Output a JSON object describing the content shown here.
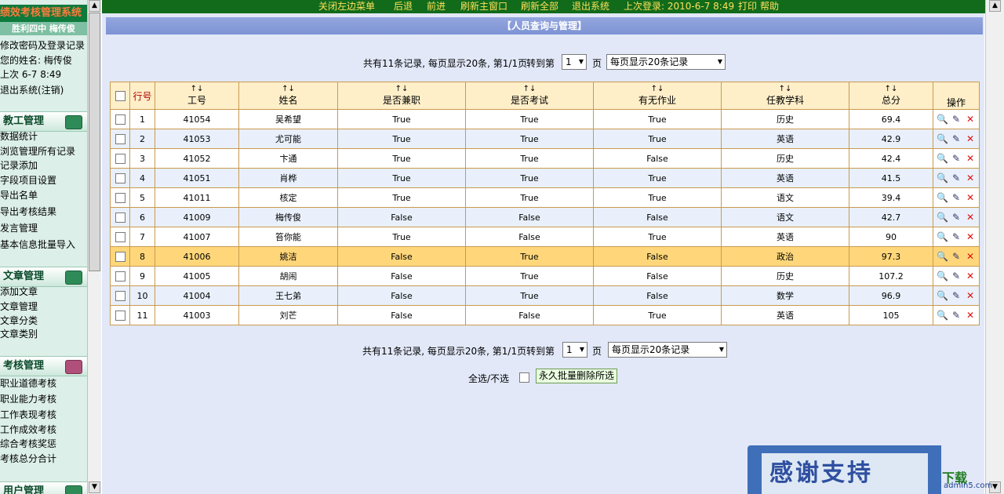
{
  "sidebar": {
    "title": "绩效考核管理系统",
    "school": "胜利四中  梅传俊",
    "user_lines": [
      "修改密码及登录记录",
      "您的姓名: 梅传俊",
      "上次 6-7 8:49",
      "退出系统(注销)"
    ],
    "sections": [
      {
        "label": "教工管理",
        "items": [
          "数据统计",
          "浏览管理所有记录",
          "记录添加",
          "字段项目设置",
          "导出名单",
          "导出考核结果",
          "发言管理",
          "基本信息批量导入"
        ]
      },
      {
        "label": "文章管理",
        "items": [
          "添加文章",
          "文章管理",
          "文章分类",
          "文章类别"
        ]
      },
      {
        "label": "考核管理",
        "items": [
          "职业道德考核",
          "职业能力考核",
          "工作表现考核",
          "工作成效考核",
          "综合考核奖惩",
          "考核总分合计"
        ]
      },
      {
        "label": "用户管理",
        "items": []
      }
    ]
  },
  "topbar": {
    "links": [
      "关闭左边菜单",
      "后退",
      "前进",
      "刷新主窗口",
      "刷新全部",
      "退出系统"
    ],
    "last_login": "上次登录: 2010-6-7 8:49",
    "print": "打印",
    "help": "帮助"
  },
  "main": {
    "panel_title": "【人员查询与管理】",
    "pager": {
      "summary": "共有11条记录, 每页显示20条, 第1/1页",
      "goto_label": "转到第",
      "page_value": "1",
      "page_unit": "页",
      "per_page": "每页显示20条记录"
    },
    "table": {
      "sort_glyph": "↑↓",
      "headers": [
        "行号",
        "工号",
        "姓名",
        "是否兼职",
        "是否考试",
        "有无作业",
        "任教学科",
        "总分",
        "操作"
      ],
      "rows": [
        [
          "1",
          "41054",
          "吴希望",
          "True",
          "True",
          "True",
          "历史",
          "69.4"
        ],
        [
          "2",
          "41053",
          "尤可能",
          "True",
          "True",
          "True",
          "英语",
          "42.9"
        ],
        [
          "3",
          "41052",
          "卞通",
          "True",
          "True",
          "False",
          "历史",
          "42.4"
        ],
        [
          "4",
          "41051",
          "肖桦",
          "True",
          "True",
          "True",
          "英语",
          "41.5"
        ],
        [
          "5",
          "41011",
          "核定",
          "True",
          "True",
          "True",
          "语文",
          "39.4"
        ],
        [
          "6",
          "41009",
          "梅传俊",
          "False",
          "False",
          "False",
          "语文",
          "42.7"
        ],
        [
          "7",
          "41007",
          "笞你能",
          "True",
          "False",
          "True",
          "英语",
          "90"
        ],
        [
          "8",
          "41006",
          "姚洁",
          "False",
          "True",
          "False",
          "政治",
          "97.3"
        ],
        [
          "9",
          "41005",
          "胡闹",
          "False",
          "True",
          "False",
          "历史",
          "107.2"
        ],
        [
          "10",
          "41004",
          "王七弟",
          "False",
          "True",
          "False",
          "数学",
          "96.9"
        ],
        [
          "11",
          "41003",
          "刘芒",
          "False",
          "False",
          "True",
          "英语",
          "105"
        ]
      ],
      "highlight_row": 7
    },
    "select_all_label": "全选/不选",
    "bulk_delete_label": "永久批量删除所选"
  },
  "promo": {
    "text": "感谢支持",
    "green": "下载",
    "site": "admin5.com"
  }
}
